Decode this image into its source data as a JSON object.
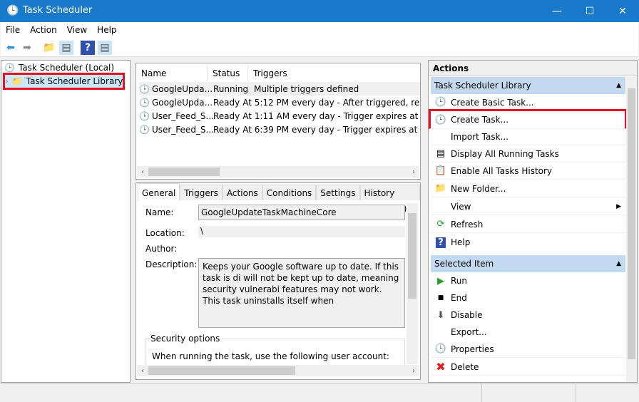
{
  "window": {
    "title": "Task Scheduler",
    "minimize": "—",
    "maximize": "☐",
    "close": "✕"
  },
  "menu": [
    "File",
    "Action",
    "View",
    "Help"
  ],
  "tree": {
    "root": "Task Scheduler (Local)",
    "library": "Task Scheduler Library"
  },
  "task_list": {
    "columns": [
      "Name",
      "Status",
      "Triggers"
    ],
    "rows": [
      {
        "name": "GoogleUpda...",
        "status": "Running",
        "triggers": "Multiple triggers defined"
      },
      {
        "name": "GoogleUpda...",
        "status": "Ready",
        "triggers": "At 5:12 PM every day - After triggered, repeat"
      },
      {
        "name": "User_Feed_S...",
        "status": "Ready",
        "triggers": "At 1:11 AM every day - Trigger expires at 5/27"
      },
      {
        "name": "User_Feed_S...",
        "status": "Ready",
        "triggers": "At 6:39 PM every day - Trigger expires at 11/1"
      }
    ]
  },
  "details": {
    "tabs": [
      "General",
      "Triggers",
      "Actions",
      "Conditions",
      "Settings",
      "History (disabled)"
    ],
    "name_label": "Name:",
    "name_value": "GoogleUpdateTaskMachineCore",
    "location_label": "Location:",
    "location_value": "\\",
    "author_label": "Author:",
    "description_label": "Description:",
    "description_value": "Keeps your Google software up to date. If this task is di will not be kept up to date, meaning security vulnerabi features may not work. This task uninstalls itself when",
    "security_title": "Security options",
    "security_text": "When running the task, use the following user account:"
  },
  "actions": {
    "title": "Actions",
    "section1": "Task Scheduler Library",
    "items1": [
      "Create Basic Task...",
      "Create Task...",
      "Import Task...",
      "Display All Running Tasks",
      "Enable All Tasks History",
      "New Folder...",
      "View",
      "Refresh",
      "Help"
    ],
    "section2": "Selected Item",
    "items2": [
      "Run",
      "End",
      "Disable",
      "Export...",
      "Properties",
      "Delete"
    ]
  },
  "colors": {
    "titlebar": "#1979ca",
    "highlight": "#e81123",
    "section": "#c3d9ef"
  }
}
